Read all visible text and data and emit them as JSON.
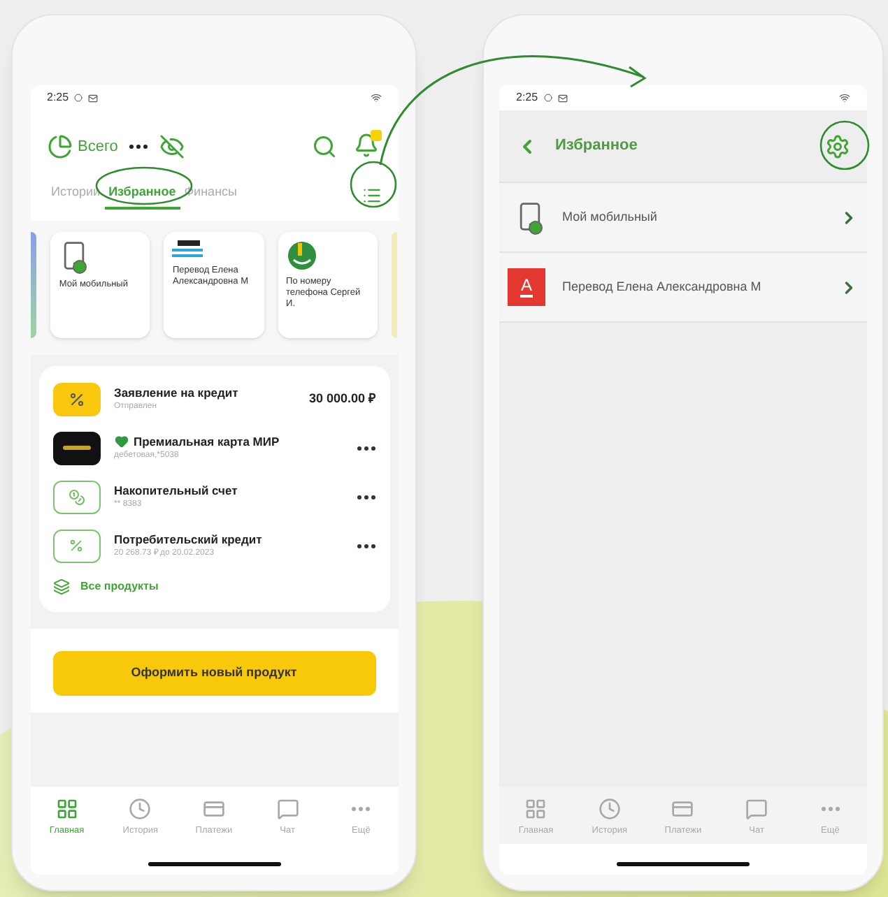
{
  "home_screen": {
    "status_bar": {
      "time": "2:25"
    },
    "header": {
      "total_label": "Всего"
    },
    "tabs": [
      {
        "label": "Истории",
        "selected": false
      },
      {
        "label": "Избранное",
        "selected": true
      },
      {
        "label": "Финансы",
        "selected": false
      }
    ],
    "favorites": [
      {
        "kind": "phone",
        "label": "Мой мобильный"
      },
      {
        "kind": "bank",
        "label": "Перевод Елена Александровна М"
      },
      {
        "kind": "sber",
        "label": "По номеру телефона Сергей И."
      }
    ],
    "products": [
      {
        "kind": "loan_request",
        "title": "Заявление на кредит",
        "subtitle": "Отправлен",
        "amount": "30 000.00 ₽",
        "favorite": false
      },
      {
        "kind": "card",
        "title": "Премиальная карта МИР",
        "subtitle": "дебетовая,*5038",
        "favorite": true
      },
      {
        "kind": "savings",
        "title": "Накопительный счет",
        "subtitle": "** 8383",
        "favorite": false
      },
      {
        "kind": "credit",
        "title": "Потребительский кредит",
        "subtitle": "20 268.73 ₽ до 20.02.2023",
        "favorite": false
      }
    ],
    "all_products": "Все продукты",
    "new_product_button": "Оформить новый продукт",
    "bottom_nav": [
      {
        "kind": "home",
        "label": "Главная",
        "selected": true
      },
      {
        "kind": "history",
        "label": "История",
        "selected": false
      },
      {
        "kind": "payments",
        "label": "Платежи",
        "selected": false
      },
      {
        "kind": "chat",
        "label": "Чат",
        "selected": false
      },
      {
        "kind": "more",
        "label": "Ещё",
        "selected": false
      }
    ]
  },
  "favorites_screen": {
    "status_bar": {
      "time": "2:25"
    },
    "title": "Избранное",
    "items": [
      {
        "kind": "phone",
        "label": "Мой мобильный"
      },
      {
        "kind": "bank",
        "label": "Перевод Елена Александровна М",
        "logo_letter": "А"
      }
    ],
    "bottom_nav": [
      {
        "kind": "home",
        "label": "Главная",
        "selected": false
      },
      {
        "kind": "history",
        "label": "История",
        "selected": false
      },
      {
        "kind": "payments",
        "label": "Платежи",
        "selected": false
      },
      {
        "kind": "chat",
        "label": "Чат",
        "selected": false
      },
      {
        "kind": "more",
        "label": "Ещё",
        "selected": false
      }
    ]
  }
}
